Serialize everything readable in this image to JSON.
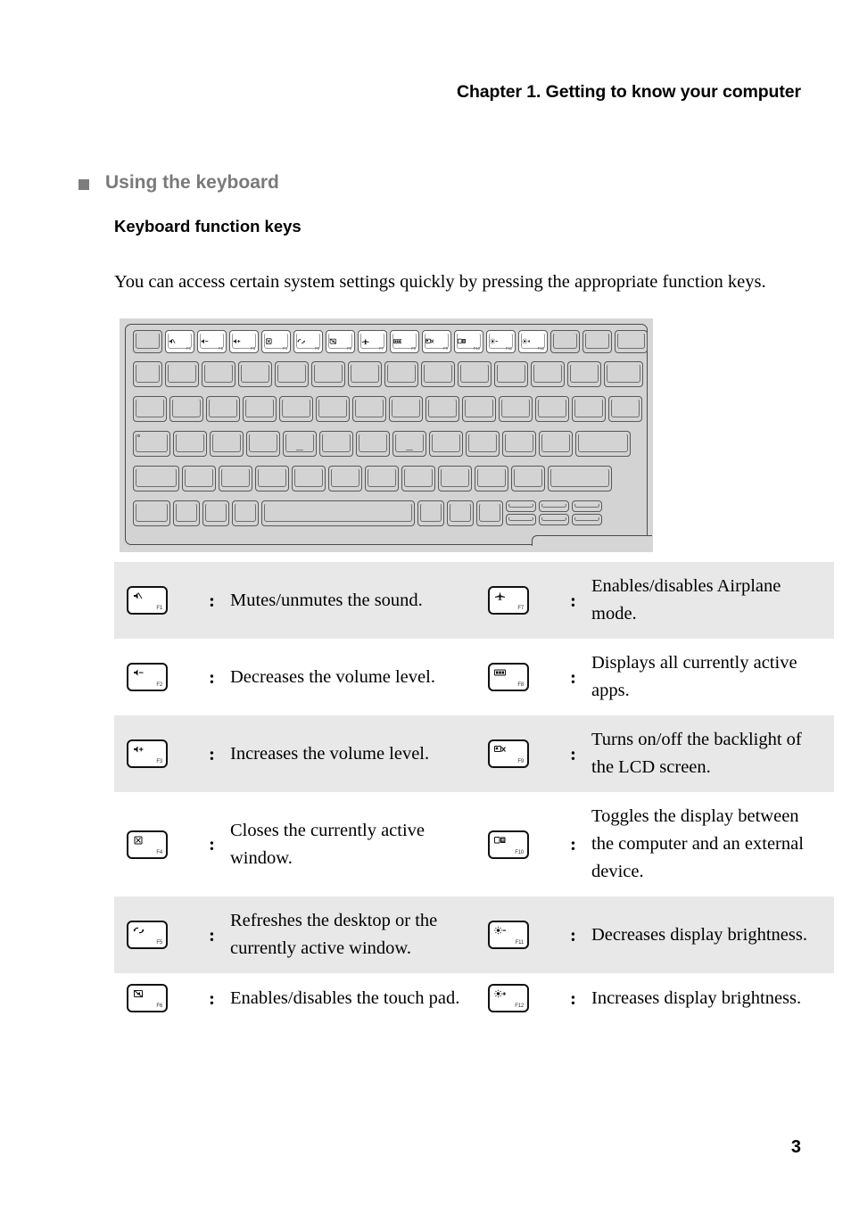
{
  "header": {
    "chapter_title": "Chapter 1. Getting to know your computer"
  },
  "section": {
    "bullet_heading": "Using the keyboard",
    "sub_heading": "Keyboard function keys",
    "intro_paragraph": "You can access certain system settings quickly by pressing the appropriate function keys."
  },
  "keyboard_figure": {
    "function_row": [
      {
        "label": "F1",
        "icon": "mute-icon",
        "glyph": "☐"
      },
      {
        "label": "F2",
        "icon": "volume-down-icon",
        "glyph": "☐"
      },
      {
        "label": "F3",
        "icon": "volume-up-icon",
        "glyph": "☐"
      },
      {
        "label": "F4",
        "icon": "close-window-icon",
        "glyph": "☐"
      },
      {
        "label": "F5",
        "icon": "refresh-icon",
        "glyph": "☐"
      },
      {
        "label": "F6",
        "icon": "touchpad-toggle-icon",
        "glyph": "☐"
      },
      {
        "label": "F7",
        "icon": "airplane-mode-icon",
        "glyph": "☐"
      },
      {
        "label": "F8",
        "icon": "active-apps-icon",
        "glyph": "☐"
      },
      {
        "label": "F9",
        "icon": "lcd-backlight-off-icon",
        "glyph": "☐"
      },
      {
        "label": "F10",
        "icon": "display-toggle-icon",
        "glyph": "☐"
      },
      {
        "label": "F11",
        "icon": "brightness-down-icon",
        "glyph": "☐"
      },
      {
        "label": "F12",
        "icon": "brightness-up-icon",
        "glyph": "☐"
      }
    ]
  },
  "function_key_table": {
    "rows": [
      {
        "shaded": true,
        "left": {
          "key_label": "F1",
          "icon": "mute-icon",
          "description": "Mutes/unmutes the sound."
        },
        "right": {
          "key_label": "F7",
          "icon": "airplane-mode-icon",
          "description": "Enables/disables Airplane mode."
        },
        "separator": ":"
      },
      {
        "shaded": false,
        "left": {
          "key_label": "F2",
          "icon": "volume-down-icon",
          "description": "Decreases the volume level."
        },
        "right": {
          "key_label": "F8",
          "icon": "active-apps-icon",
          "description": "Displays all currently active apps."
        },
        "separator": ":"
      },
      {
        "shaded": true,
        "left": {
          "key_label": "F3",
          "icon": "volume-up-icon",
          "description": "Increases the volume level."
        },
        "right": {
          "key_label": "F9",
          "icon": "lcd-backlight-off-icon",
          "description": "Turns on/off the backlight of the LCD screen."
        },
        "separator": ":"
      },
      {
        "shaded": false,
        "left": {
          "key_label": "F4",
          "icon": "close-window-icon",
          "description": "Closes the currently active window."
        },
        "right": {
          "key_label": "F10",
          "icon": "display-toggle-icon",
          "description": "Toggles the display between the computer and an external device."
        },
        "separator": ":"
      },
      {
        "shaded": true,
        "left": {
          "key_label": "F5",
          "icon": "refresh-icon",
          "description": "Refreshes the desktop or the currently active window."
        },
        "right": {
          "key_label": "F11",
          "icon": "brightness-down-icon",
          "description": "Decreases display brightness."
        },
        "separator": ":"
      },
      {
        "shaded": false,
        "left": {
          "key_label": "F6",
          "icon": "touchpad-toggle-icon",
          "description": "Enables/disables the touch pad."
        },
        "right": {
          "key_label": "F12",
          "icon": "brightness-up-icon",
          "description": "Increases display brightness."
        },
        "separator": ":"
      }
    ]
  },
  "footer": {
    "page_number": "3"
  },
  "colors": {
    "shaded_row": "#e8e8e8",
    "heading_gray": "#7a7a7a",
    "keyboard_bg": "#d6d6d6",
    "key_fill": "#d3d3d3",
    "key_outline": "#585858"
  }
}
